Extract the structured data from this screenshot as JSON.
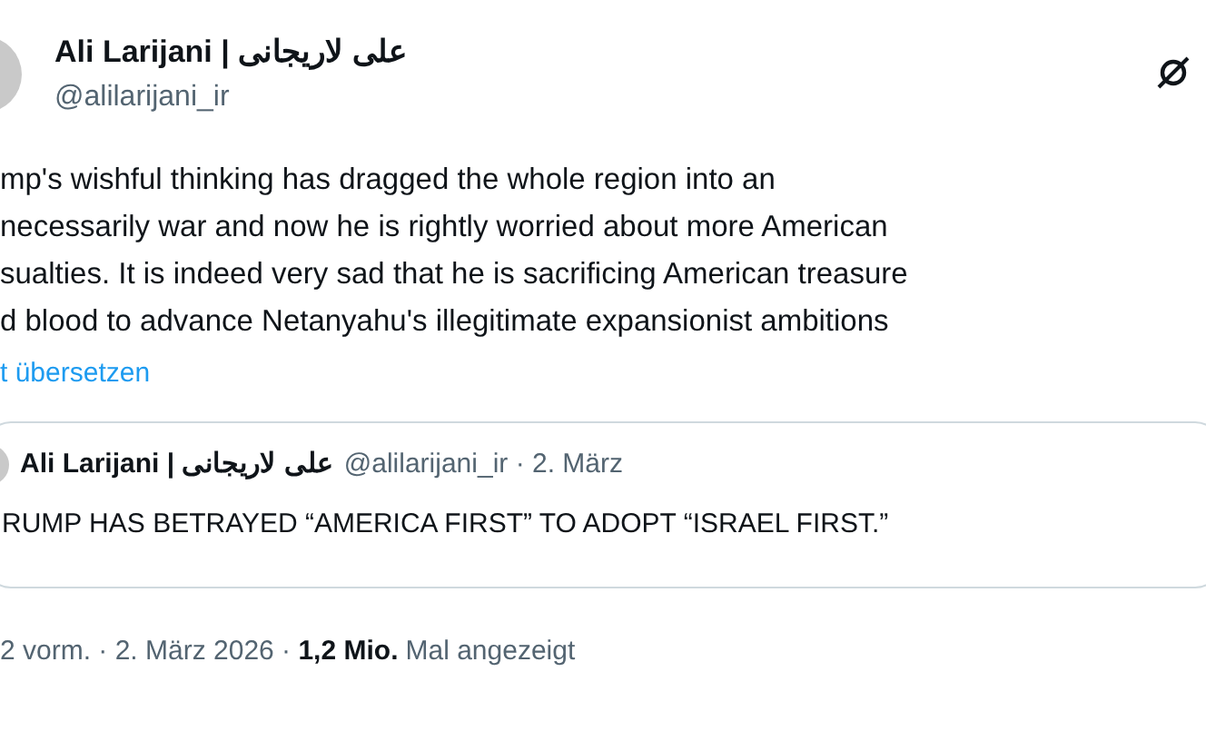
{
  "author": {
    "name": "Ali Larijani | علی لاریجانی",
    "handle": "@alilarijani_ir"
  },
  "body_lines": [
    "mp's wishful thinking has dragged the whole region into an",
    "necessarily war and now he is rightly worried about more American",
    "sualties. It is indeed very sad that he is sacrificing American treasure",
    "d blood to advance Netanyahu's illegitimate expansionist ambitions"
  ],
  "translate_link": "t übersetzen",
  "quoted_post": {
    "name": "Ali Larijani | علی لاریجانی",
    "handle_date": "@alilarijani_ir · 2. März",
    "text": "RUMP HAS BETRAYED “AMERICA FIRST” TO ADOPT “ISRAEL FIRST.”"
  },
  "footer": {
    "time_date": "2 vorm. · 2. März 2026 · ",
    "views": "1,2 Mio.",
    "views_label": "Mal angezeigt"
  }
}
